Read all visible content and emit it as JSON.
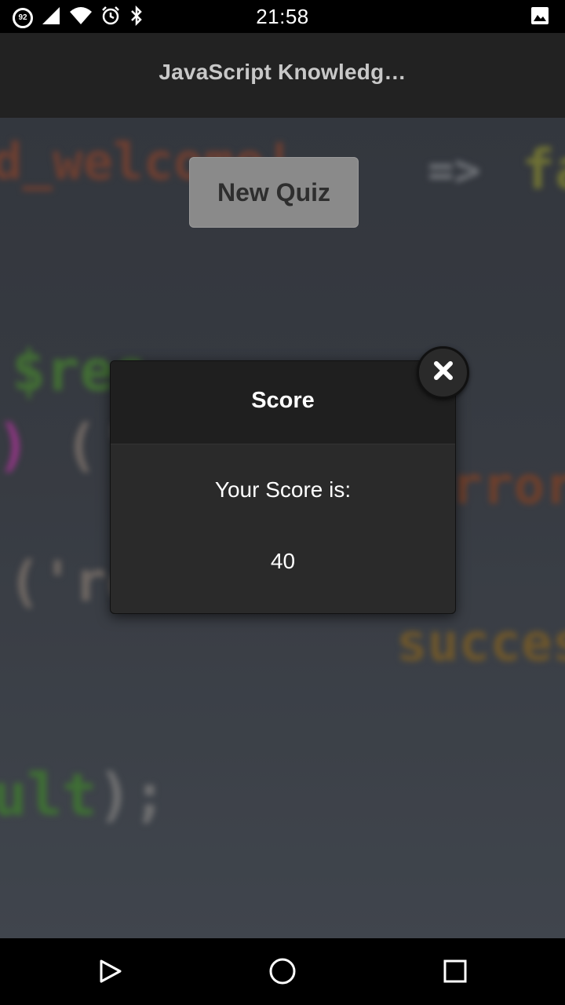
{
  "status_bar": {
    "time": "21:58",
    "battery_level": "92",
    "icons_left": [
      "battery-icon",
      "signal-icon",
      "wifi-icon",
      "alarm-icon",
      "bluetooth-icon"
    ],
    "icons_right": [
      "image-notification-icon"
    ]
  },
  "app_bar": {
    "title": "JavaScript Knowledg…"
  },
  "main": {
    "new_quiz_label": "New Quiz"
  },
  "modal": {
    "title": "Score",
    "score_label": "Your Score is:",
    "score_value": "40",
    "close_icon": "close-icon"
  },
  "nav_bar": {
    "buttons": [
      "back-icon",
      "home-icon",
      "recents-icon"
    ]
  },
  "colors": {
    "status_bar": "#000000",
    "app_bar": "#222222",
    "modal_header": "#1f1f1f",
    "modal_body": "#2a2a2a",
    "button": "#8a8a8a"
  }
}
